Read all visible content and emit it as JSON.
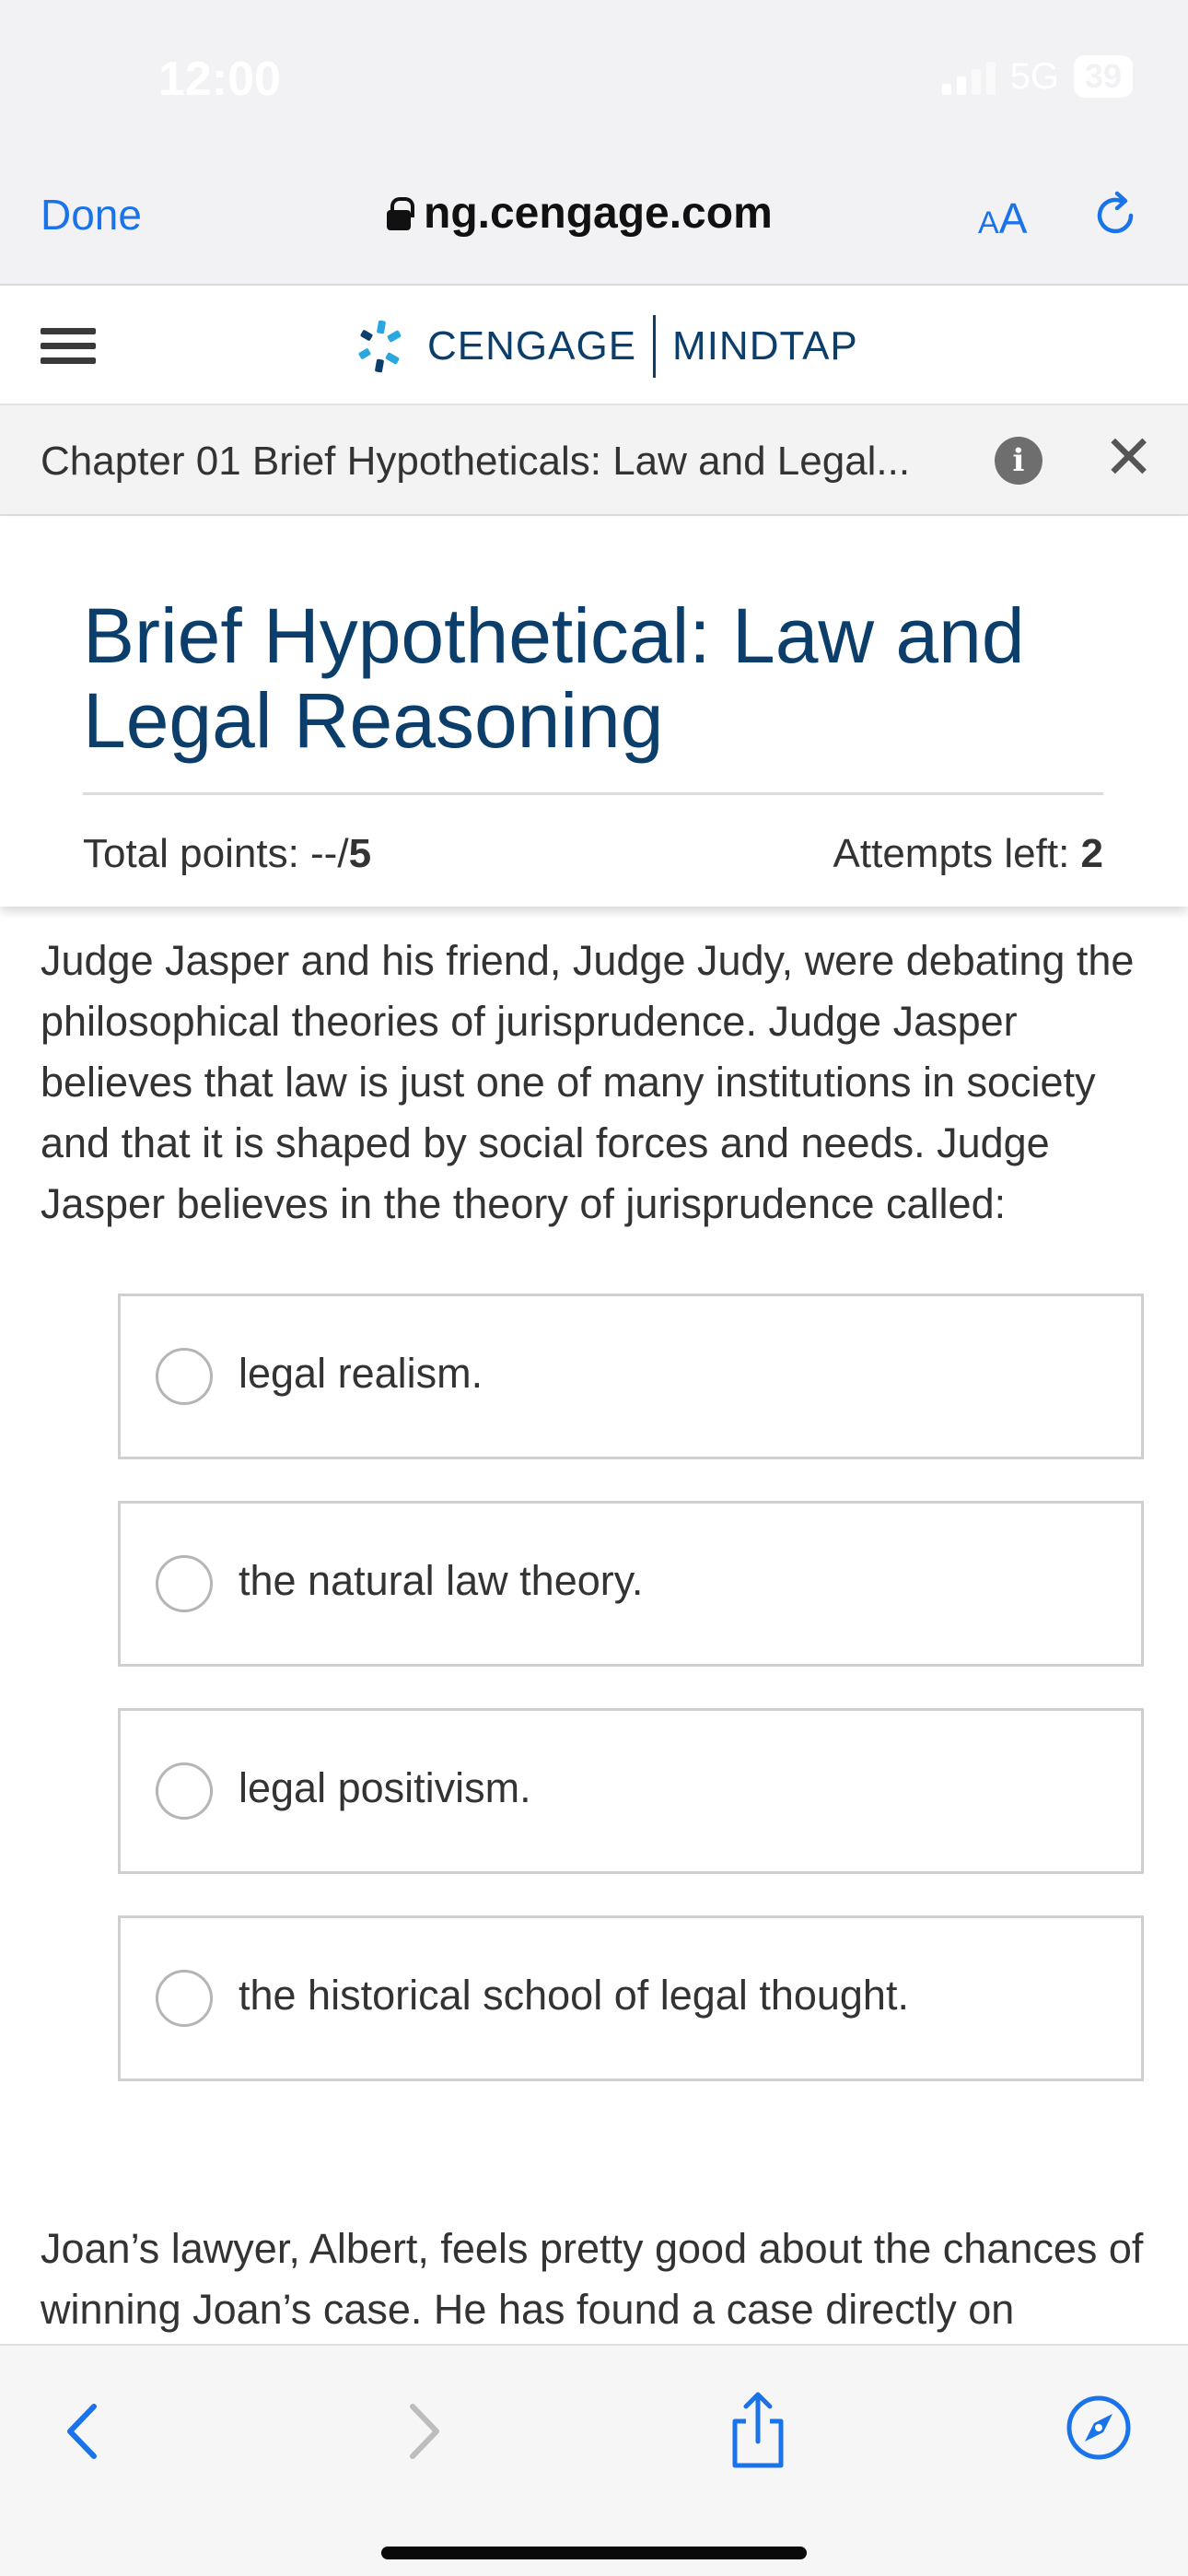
{
  "status_bar": {
    "time": "12:00",
    "network": "5G",
    "battery": "39"
  },
  "browser": {
    "done_label": "Done",
    "url": "ng.cengage.com",
    "text_size_small": "A",
    "text_size_large": "A",
    "accent_color": "#1a73e8"
  },
  "app_header": {
    "brand_left": "CENGAGE",
    "brand_right": "MINDTAP",
    "brand_color": "#0c3e6b"
  },
  "chapter_bar": {
    "title": "Chapter 01 Brief Hypotheticals: Law and Legal...",
    "info_glyph": "i",
    "close_glyph": "✕"
  },
  "assignment": {
    "title": "Brief Hypothetical: Law and Legal Reasoning",
    "points_label": "Total points: --/",
    "points_total": "5",
    "attempts_label": "Attempts left: ",
    "attempts_value": "2"
  },
  "question1": {
    "text": "Judge Jasper and his friend, Judge Judy, were debating the philosophical theories of jurisprudence. Judge Jasper believes that law is just one of many institutions in society and that it is shaped by social forces and needs. Judge Jasper believes in the theory of jurisprudence called:",
    "options": [
      "legal realism.",
      "the natural law theory.",
      "legal positivism.",
      "the historical school of legal thought."
    ]
  },
  "question2": {
    "text": "Joan’s lawyer, Albert, feels pretty good about the chances of winning Joan’s case. He has found a case directly on"
  },
  "bottom_bar": {
    "icons": [
      "back-icon",
      "forward-icon",
      "share-icon",
      "compass-icon"
    ]
  }
}
